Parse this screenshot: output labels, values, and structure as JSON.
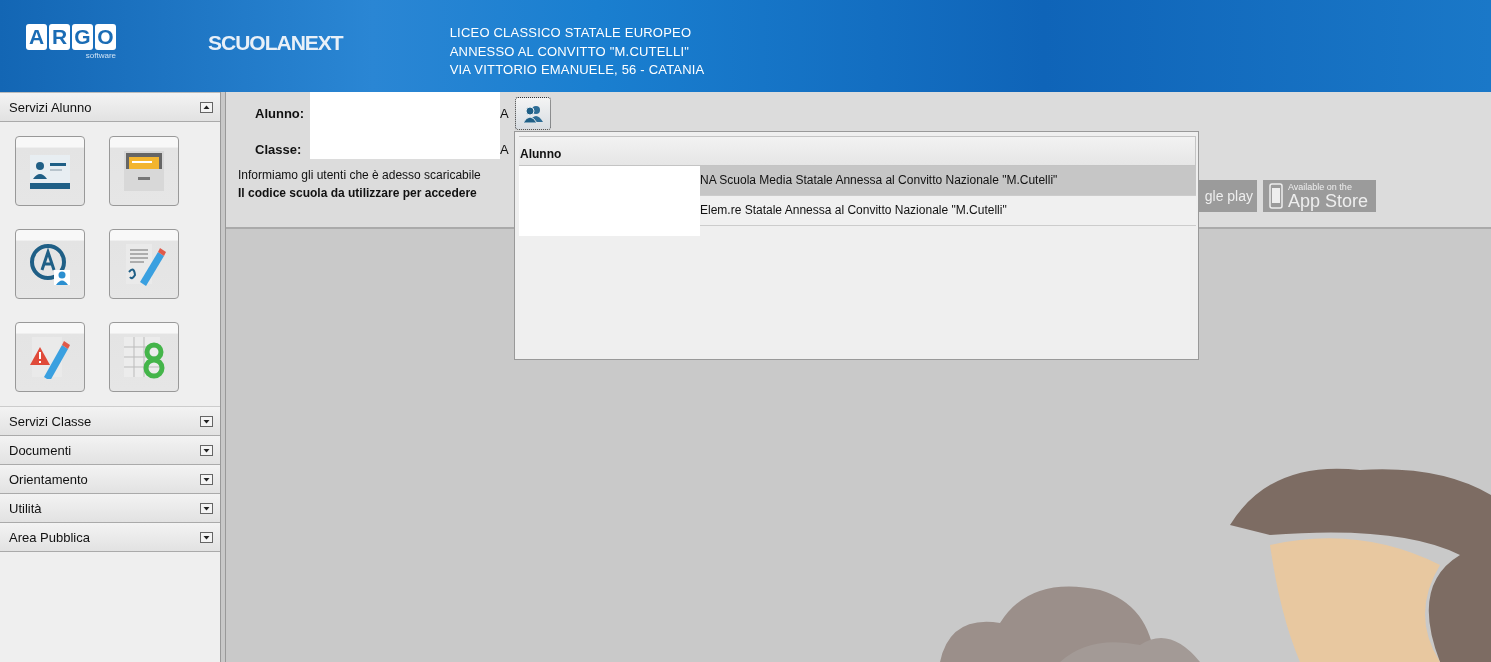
{
  "header": {
    "logo_letters": [
      "A",
      "R",
      "G",
      "O"
    ],
    "logo_sub": "software",
    "app_name": "SCUOLANEXT",
    "school_lines": [
      "LICEO CLASSICO STATALE EUROPEO",
      "ANNESSO AL CONVITTO \"M.CUTELLI\"",
      "VIA VITTORIO EMANUELE, 56 - CATANIA"
    ]
  },
  "sidebar": {
    "sections": [
      {
        "label": "Servizi Alunno",
        "expanded": true,
        "tiles": [
          {
            "kind": "id-card"
          },
          {
            "kind": "folder"
          },
          {
            "kind": "user-a"
          },
          {
            "kind": "grade"
          },
          {
            "kind": "warning"
          },
          {
            "kind": "grid"
          }
        ]
      },
      {
        "label": "Servizi Classe",
        "expanded": false
      },
      {
        "label": "Documenti",
        "expanded": false
      },
      {
        "label": "Orientamento",
        "expanded": false
      },
      {
        "label": "Utilità",
        "expanded": false
      },
      {
        "label": "Area Pubblica",
        "expanded": false
      }
    ]
  },
  "student_panel": {
    "alunno_label": "Alunno:",
    "alunno_value": "A",
    "classe_label": "Classe:",
    "classe_value": "A",
    "info_text": "Informiamo gli utenti che è adesso scaricabile",
    "code_text": "Il codice scuola da utilizzare per accedere",
    "store_badges": [
      {
        "kind": "google",
        "big": "gle play"
      },
      {
        "kind": "apple",
        "small": "Available on the",
        "big": "App Store"
      }
    ]
  },
  "student_popup": {
    "header": "Alunno",
    "rows": [
      {
        "text": "NA Scuola Media Statale Annessa al Convitto Nazionale \"M.Cutelli\"",
        "selected": true
      },
      {
        "text": "Elem.re Statale Annessa al Convitto Nazionale \"M.Cutelli\"",
        "selected": false
      }
    ]
  }
}
